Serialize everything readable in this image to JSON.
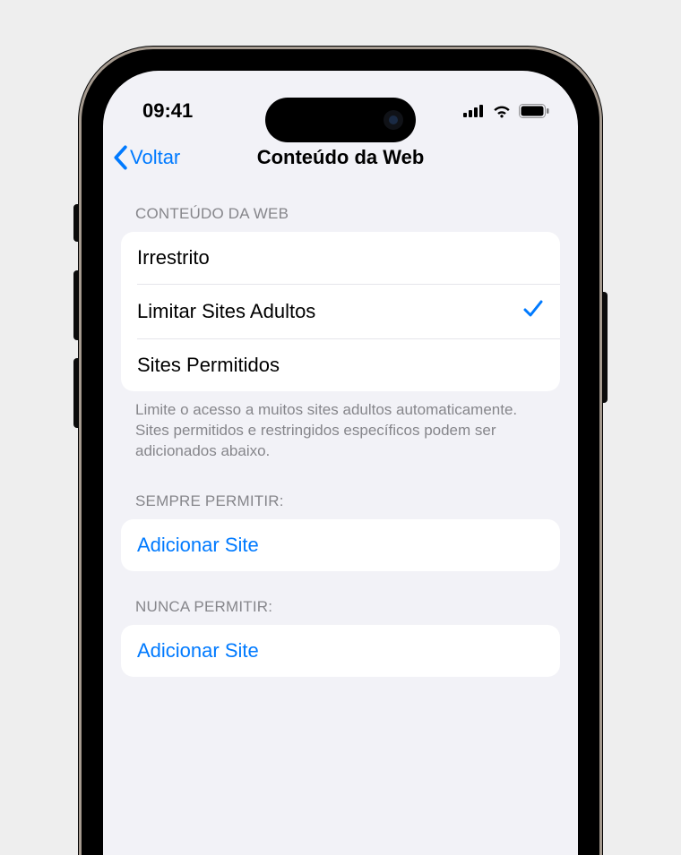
{
  "status": {
    "time": "09:41"
  },
  "nav": {
    "back_label": "Voltar",
    "title": "Conteúdo da Web"
  },
  "sections": {
    "web_content": {
      "header": "CONTEÚDO DA WEB",
      "options": {
        "unrestricted": "Irrestrito",
        "limit_adult": "Limitar Sites Adultos",
        "allowed_only": "Sites Permitidos"
      },
      "footer": "Limite o acesso a muitos sites adultos automaticamente. Sites permitidos e restringidos específicos podem ser adicionados abaixo."
    },
    "always_allow": {
      "header": "SEMPRE PERMITIR:",
      "add_label": "Adicionar Site"
    },
    "never_allow": {
      "header": "NUNCA PERMITIR:",
      "add_label": "Adicionar Site"
    }
  }
}
